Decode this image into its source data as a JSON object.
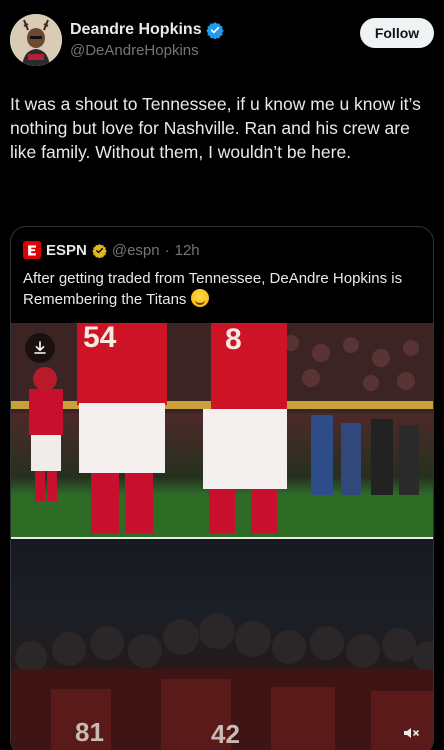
{
  "author": {
    "name": "Deandre Hopkins",
    "handle": "@DeAndreHopkins",
    "follow_label": "Follow"
  },
  "tweet": {
    "text": "It was a shout to Tennessee, if u know me u know it’s nothing but love for Nashville. Ran and his crew are like family. Without them, I wouldn’t be here."
  },
  "quote": {
    "name": "ESPN",
    "handle": "@espn",
    "separator": "·",
    "time": "12h",
    "text": "After getting traded from Tennessee, DeAndre Hopkins is Remembering the Titans",
    "jersey_top_left": "54",
    "jersey_top_right": "8",
    "jersey_bottom_left": "81",
    "jersey_bottom_right": "42"
  },
  "icons": {
    "verified": "verified-badge-icon",
    "download": "download-icon",
    "mute": "mute-icon",
    "espn_logo": "espn-logo-icon",
    "emoji": "grinning-sweat-emoji-icon"
  },
  "colors": {
    "background": "#000000",
    "accent_blue": "#1d9bf0",
    "gold_verified": "#e2b719",
    "espn_red": "#dd0000",
    "chiefs_red": "#c8102e"
  }
}
